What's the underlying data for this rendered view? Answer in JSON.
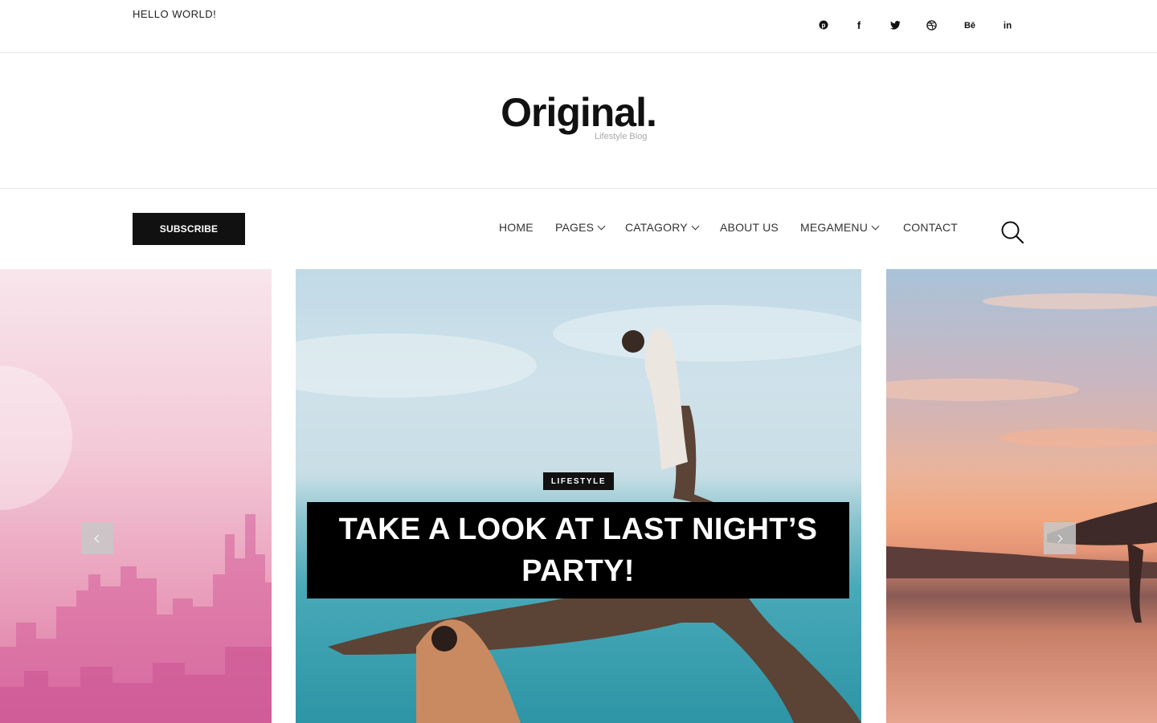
{
  "topbar": {
    "hello_text": "HELLO WORLD!",
    "social": [
      {
        "icon": "pinterest-icon",
        "glyph": "℗"
      },
      {
        "icon": "facebook-icon",
        "glyph": "f"
      },
      {
        "icon": "twitter-icon",
        "glyph": "t"
      },
      {
        "icon": "dribbble-icon",
        "glyph": "⊛"
      },
      {
        "icon": "behance-icon",
        "glyph": "Bē"
      },
      {
        "icon": "linkedin-icon",
        "glyph": "in"
      }
    ]
  },
  "brand": {
    "logo": "Original.",
    "tagline": "Lifestyle Blog"
  },
  "nav": {
    "subscribe_label": "SUBSCRIBE",
    "items": [
      {
        "label": "HOME",
        "dropdown": false
      },
      {
        "label": "PAGES",
        "dropdown": true
      },
      {
        "label": "CATAGORY",
        "dropdown": true
      },
      {
        "label": "ABOUT US",
        "dropdown": false
      },
      {
        "label": "MEGAMENU",
        "dropdown": true
      },
      {
        "label": "CONTACT",
        "dropdown": false
      }
    ],
    "search_icon": "search-icon"
  },
  "slider": {
    "featured": {
      "category": "LIFESTYLE",
      "title": "TAKE A LOOK AT LAST NIGHT’S PARTY!"
    },
    "prev_icon": "chevron-left-icon",
    "next_icon": "chevron-right-icon"
  },
  "colors": {
    "accent": "#111111",
    "border": "#e6e6e6",
    "tagline": "#aaaaaa"
  }
}
